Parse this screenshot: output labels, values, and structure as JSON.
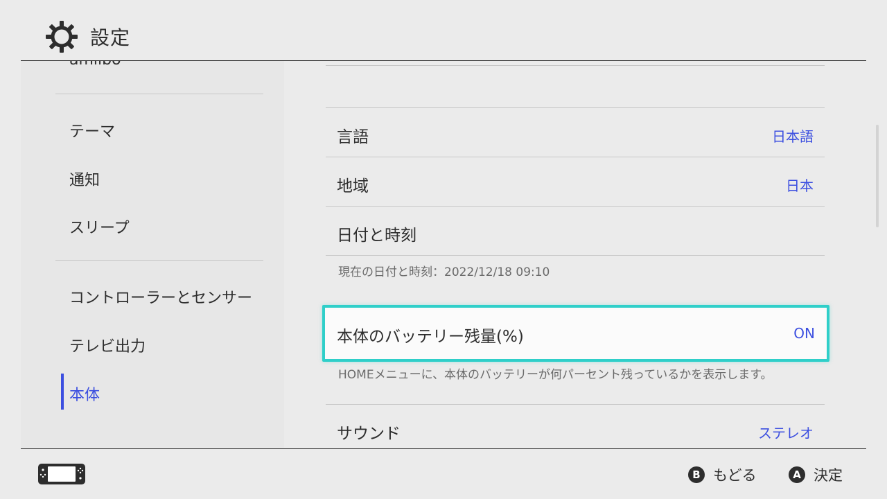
{
  "header": {
    "title": "設定",
    "icon": "gear-icon"
  },
  "sidebar": {
    "partial_item": "amiibo",
    "items": [
      {
        "label": "テーマ"
      },
      {
        "label": "通知"
      },
      {
        "label": "スリープ"
      },
      {
        "label": "コントローラーとセンサー"
      },
      {
        "label": "テレビ出力"
      },
      {
        "label": "本体",
        "active": true
      }
    ]
  },
  "main": {
    "language": {
      "label": "言語",
      "value": "日本語"
    },
    "region": {
      "label": "地域",
      "value": "日本"
    },
    "datetime": {
      "label": "日付と時刻",
      "sub": "現在の日付と時刻：2022/12/18 09:10"
    },
    "battery": {
      "label": "本体のバッテリー残量(%)",
      "value": "ON",
      "sub": "HOMEメニューに、本体のバッテリーが何パーセント残っているかを表示します。"
    },
    "sound": {
      "label": "サウンド",
      "value": "ステレオ"
    }
  },
  "footer": {
    "back": {
      "key": "B",
      "label": "もどる"
    },
    "ok": {
      "key": "A",
      "label": "決定"
    }
  },
  "colors": {
    "accent": "#3c4fe0",
    "highlight": "#2fcfc9",
    "background": "#ebebeb"
  }
}
